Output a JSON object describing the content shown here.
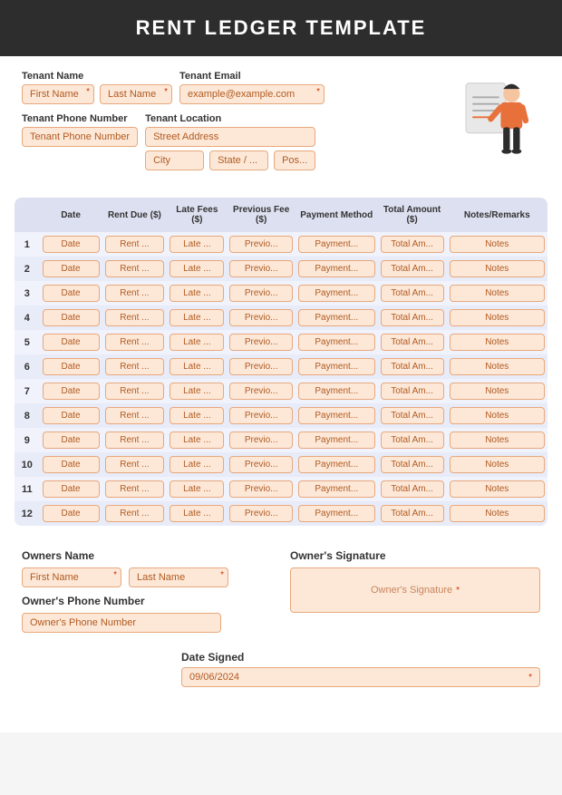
{
  "header": {
    "title": "RENT LEDGER TEMPLATE"
  },
  "tenant": {
    "name_label": "Tenant Name",
    "first_name_placeholder": "First Name",
    "last_name_placeholder": "Last Name",
    "email_label": "Tenant Email",
    "email_placeholder": "example@example.com",
    "phone_label": "Tenant Phone Number",
    "phone_placeholder": "Tenant Phone Number",
    "location_label": "Tenant Location",
    "street_placeholder": "Street Address",
    "city_placeholder": "City",
    "state_placeholder": "State / ...",
    "postal_placeholder": "Pos..."
  },
  "table": {
    "headers": [
      "",
      "Date",
      "Rent Due ($)",
      "Late Fees ($)",
      "Previous Fee ($)",
      "Payment Method",
      "Total Amount ($)",
      "Notes/Remarks"
    ],
    "rows": [
      {
        "num": "1",
        "date": "Date",
        "rent": "Rent ...",
        "late": "Late ...",
        "prev": "Previo...",
        "pay": "Payment...",
        "total": "Total Am...",
        "notes": "Notes"
      },
      {
        "num": "2",
        "date": "Date",
        "rent": "Rent ...",
        "late": "Late ...",
        "prev": "Previo...",
        "pay": "Payment...",
        "total": "Total Am...",
        "notes": "Notes"
      },
      {
        "num": "3",
        "date": "Date",
        "rent": "Rent ...",
        "late": "Late ...",
        "prev": "Previo...",
        "pay": "Payment...",
        "total": "Total Am...",
        "notes": "Notes"
      },
      {
        "num": "4",
        "date": "Date",
        "rent": "Rent ...",
        "late": "Late ...",
        "prev": "Previo...",
        "pay": "Payment...",
        "total": "Total Am...",
        "notes": "Notes"
      },
      {
        "num": "5",
        "date": "Date",
        "rent": "Rent ...",
        "late": "Late ...",
        "prev": "Previo...",
        "pay": "Payment...",
        "total": "Total Am...",
        "notes": "Notes"
      },
      {
        "num": "6",
        "date": "Date",
        "rent": "Rent ...",
        "late": "Late ...",
        "prev": "Previo...",
        "pay": "Payment...",
        "total": "Total Am...",
        "notes": "Notes"
      },
      {
        "num": "7",
        "date": "Date",
        "rent": "Rent ...",
        "late": "Late ...",
        "prev": "Previo...",
        "pay": "Payment...",
        "total": "Total Am...",
        "notes": "Notes"
      },
      {
        "num": "8",
        "date": "Date",
        "rent": "Rent ...",
        "late": "Late ...",
        "prev": "Previo...",
        "pay": "Payment...",
        "total": "Total Am...",
        "notes": "Notes"
      },
      {
        "num": "9",
        "date": "Date",
        "rent": "Rent ...",
        "late": "Late ...",
        "prev": "Previo...",
        "pay": "Payment...",
        "total": "Total Am...",
        "notes": "Notes"
      },
      {
        "num": "10",
        "date": "Date",
        "rent": "Rent ...",
        "late": "Late ...",
        "prev": "Previo...",
        "pay": "Payment...",
        "total": "Total Am...",
        "notes": "Notes"
      },
      {
        "num": "11",
        "date": "Date",
        "rent": "Rent ...",
        "late": "Late ...",
        "prev": "Previo...",
        "pay": "Payment...",
        "total": "Total Am...",
        "notes": "Notes"
      },
      {
        "num": "12",
        "date": "Date",
        "rent": "Rent ...",
        "late": "Late ...",
        "prev": "Previo...",
        "pay": "Payment...",
        "total": "Total Am...",
        "notes": "Notes"
      }
    ]
  },
  "owner": {
    "name_label": "Owners Name",
    "first_name_placeholder": "First Name",
    "last_name_placeholder": "Last Name",
    "phone_label": "Owner's Phone Number",
    "phone_placeholder": "Owner's Phone Number",
    "signature_label": "Owner's Signature",
    "signature_placeholder": "Owner's Signature",
    "date_label": "Date Signed",
    "date_value": "09/06/2024"
  },
  "icons": {
    "required_star": "*"
  }
}
